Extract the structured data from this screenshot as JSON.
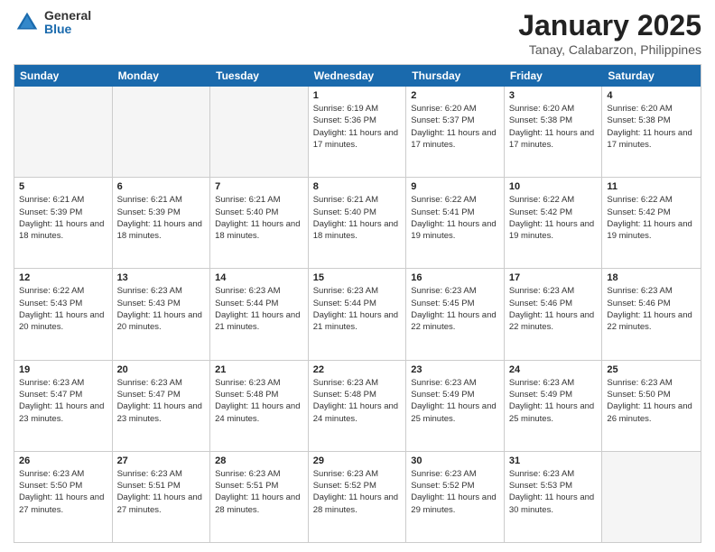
{
  "header": {
    "logo_general": "General",
    "logo_blue": "Blue",
    "title": "January 2025",
    "subtitle": "Tanay, Calabarzon, Philippines"
  },
  "day_headers": [
    "Sunday",
    "Monday",
    "Tuesday",
    "Wednesday",
    "Thursday",
    "Friday",
    "Saturday"
  ],
  "weeks": [
    [
      {
        "num": "",
        "sunrise": "",
        "sunset": "",
        "daylight": "",
        "empty": true
      },
      {
        "num": "",
        "sunrise": "",
        "sunset": "",
        "daylight": "",
        "empty": true
      },
      {
        "num": "",
        "sunrise": "",
        "sunset": "",
        "daylight": "",
        "empty": true
      },
      {
        "num": "1",
        "sunrise": "Sunrise: 6:19 AM",
        "sunset": "Sunset: 5:36 PM",
        "daylight": "Daylight: 11 hours and 17 minutes.",
        "empty": false
      },
      {
        "num": "2",
        "sunrise": "Sunrise: 6:20 AM",
        "sunset": "Sunset: 5:37 PM",
        "daylight": "Daylight: 11 hours and 17 minutes.",
        "empty": false
      },
      {
        "num": "3",
        "sunrise": "Sunrise: 6:20 AM",
        "sunset": "Sunset: 5:38 PM",
        "daylight": "Daylight: 11 hours and 17 minutes.",
        "empty": false
      },
      {
        "num": "4",
        "sunrise": "Sunrise: 6:20 AM",
        "sunset": "Sunset: 5:38 PM",
        "daylight": "Daylight: 11 hours and 17 minutes.",
        "empty": false
      }
    ],
    [
      {
        "num": "5",
        "sunrise": "Sunrise: 6:21 AM",
        "sunset": "Sunset: 5:39 PM",
        "daylight": "Daylight: 11 hours and 18 minutes.",
        "empty": false
      },
      {
        "num": "6",
        "sunrise": "Sunrise: 6:21 AM",
        "sunset": "Sunset: 5:39 PM",
        "daylight": "Daylight: 11 hours and 18 minutes.",
        "empty": false
      },
      {
        "num": "7",
        "sunrise": "Sunrise: 6:21 AM",
        "sunset": "Sunset: 5:40 PM",
        "daylight": "Daylight: 11 hours and 18 minutes.",
        "empty": false
      },
      {
        "num": "8",
        "sunrise": "Sunrise: 6:21 AM",
        "sunset": "Sunset: 5:40 PM",
        "daylight": "Daylight: 11 hours and 18 minutes.",
        "empty": false
      },
      {
        "num": "9",
        "sunrise": "Sunrise: 6:22 AM",
        "sunset": "Sunset: 5:41 PM",
        "daylight": "Daylight: 11 hours and 19 minutes.",
        "empty": false
      },
      {
        "num": "10",
        "sunrise": "Sunrise: 6:22 AM",
        "sunset": "Sunset: 5:42 PM",
        "daylight": "Daylight: 11 hours and 19 minutes.",
        "empty": false
      },
      {
        "num": "11",
        "sunrise": "Sunrise: 6:22 AM",
        "sunset": "Sunset: 5:42 PM",
        "daylight": "Daylight: 11 hours and 19 minutes.",
        "empty": false
      }
    ],
    [
      {
        "num": "12",
        "sunrise": "Sunrise: 6:22 AM",
        "sunset": "Sunset: 5:43 PM",
        "daylight": "Daylight: 11 hours and 20 minutes.",
        "empty": false
      },
      {
        "num": "13",
        "sunrise": "Sunrise: 6:23 AM",
        "sunset": "Sunset: 5:43 PM",
        "daylight": "Daylight: 11 hours and 20 minutes.",
        "empty": false
      },
      {
        "num": "14",
        "sunrise": "Sunrise: 6:23 AM",
        "sunset": "Sunset: 5:44 PM",
        "daylight": "Daylight: 11 hours and 21 minutes.",
        "empty": false
      },
      {
        "num": "15",
        "sunrise": "Sunrise: 6:23 AM",
        "sunset": "Sunset: 5:44 PM",
        "daylight": "Daylight: 11 hours and 21 minutes.",
        "empty": false
      },
      {
        "num": "16",
        "sunrise": "Sunrise: 6:23 AM",
        "sunset": "Sunset: 5:45 PM",
        "daylight": "Daylight: 11 hours and 22 minutes.",
        "empty": false
      },
      {
        "num": "17",
        "sunrise": "Sunrise: 6:23 AM",
        "sunset": "Sunset: 5:46 PM",
        "daylight": "Daylight: 11 hours and 22 minutes.",
        "empty": false
      },
      {
        "num": "18",
        "sunrise": "Sunrise: 6:23 AM",
        "sunset": "Sunset: 5:46 PM",
        "daylight": "Daylight: 11 hours and 22 minutes.",
        "empty": false
      }
    ],
    [
      {
        "num": "19",
        "sunrise": "Sunrise: 6:23 AM",
        "sunset": "Sunset: 5:47 PM",
        "daylight": "Daylight: 11 hours and 23 minutes.",
        "empty": false
      },
      {
        "num": "20",
        "sunrise": "Sunrise: 6:23 AM",
        "sunset": "Sunset: 5:47 PM",
        "daylight": "Daylight: 11 hours and 23 minutes.",
        "empty": false
      },
      {
        "num": "21",
        "sunrise": "Sunrise: 6:23 AM",
        "sunset": "Sunset: 5:48 PM",
        "daylight": "Daylight: 11 hours and 24 minutes.",
        "empty": false
      },
      {
        "num": "22",
        "sunrise": "Sunrise: 6:23 AM",
        "sunset": "Sunset: 5:48 PM",
        "daylight": "Daylight: 11 hours and 24 minutes.",
        "empty": false
      },
      {
        "num": "23",
        "sunrise": "Sunrise: 6:23 AM",
        "sunset": "Sunset: 5:49 PM",
        "daylight": "Daylight: 11 hours and 25 minutes.",
        "empty": false
      },
      {
        "num": "24",
        "sunrise": "Sunrise: 6:23 AM",
        "sunset": "Sunset: 5:49 PM",
        "daylight": "Daylight: 11 hours and 25 minutes.",
        "empty": false
      },
      {
        "num": "25",
        "sunrise": "Sunrise: 6:23 AM",
        "sunset": "Sunset: 5:50 PM",
        "daylight": "Daylight: 11 hours and 26 minutes.",
        "empty": false
      }
    ],
    [
      {
        "num": "26",
        "sunrise": "Sunrise: 6:23 AM",
        "sunset": "Sunset: 5:50 PM",
        "daylight": "Daylight: 11 hours and 27 minutes.",
        "empty": false
      },
      {
        "num": "27",
        "sunrise": "Sunrise: 6:23 AM",
        "sunset": "Sunset: 5:51 PM",
        "daylight": "Daylight: 11 hours and 27 minutes.",
        "empty": false
      },
      {
        "num": "28",
        "sunrise": "Sunrise: 6:23 AM",
        "sunset": "Sunset: 5:51 PM",
        "daylight": "Daylight: 11 hours and 28 minutes.",
        "empty": false
      },
      {
        "num": "29",
        "sunrise": "Sunrise: 6:23 AM",
        "sunset": "Sunset: 5:52 PM",
        "daylight": "Daylight: 11 hours and 28 minutes.",
        "empty": false
      },
      {
        "num": "30",
        "sunrise": "Sunrise: 6:23 AM",
        "sunset": "Sunset: 5:52 PM",
        "daylight": "Daylight: 11 hours and 29 minutes.",
        "empty": false
      },
      {
        "num": "31",
        "sunrise": "Sunrise: 6:23 AM",
        "sunset": "Sunset: 5:53 PM",
        "daylight": "Daylight: 11 hours and 30 minutes.",
        "empty": false
      },
      {
        "num": "",
        "sunrise": "",
        "sunset": "",
        "daylight": "",
        "empty": true
      }
    ]
  ]
}
